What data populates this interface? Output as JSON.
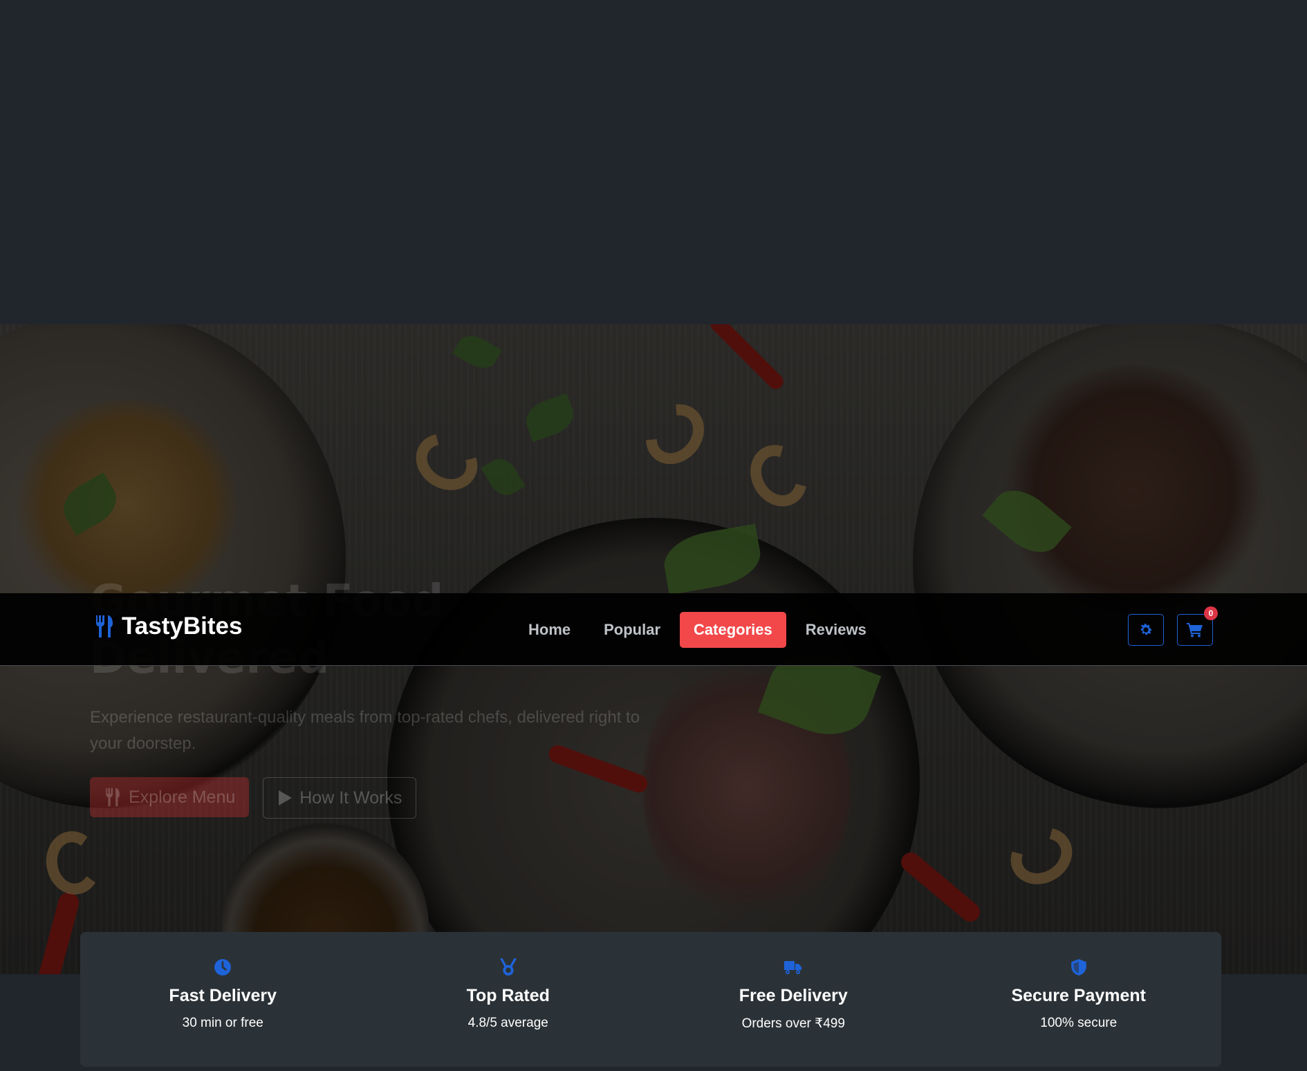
{
  "brand": {
    "name": "TastyBites",
    "logo_icon": "utensils-icon"
  },
  "nav": {
    "links": [
      {
        "label": "Home",
        "active": false
      },
      {
        "label": "Popular",
        "active": false
      },
      {
        "label": "Categories",
        "active": true
      },
      {
        "label": "Reviews",
        "active": false
      }
    ],
    "settings_icon": "gear-icon",
    "cart_icon": "cart-icon",
    "cart_count": "0"
  },
  "hero": {
    "title": "Gourmet Food Delivered",
    "subtitle": "Experience restaurant-quality meals from top-rated chefs, delivered right to your doorstep.",
    "explore_label": "Explore Menu",
    "how_label": "How It Works"
  },
  "features": [
    {
      "icon": "clock-icon",
      "title": "Fast Delivery",
      "desc": "30 min or free"
    },
    {
      "icon": "medal-icon",
      "title": "Top Rated",
      "desc": "4.8/5 average"
    },
    {
      "icon": "truck-icon",
      "title": "Free Delivery",
      "desc": "Orders over ₹499"
    },
    {
      "icon": "shield-icon",
      "title": "Secure Payment",
      "desc": "100% secure"
    }
  ],
  "colors": {
    "accent_red": "#f2484a",
    "accent_blue": "#1e63d8",
    "page_bg": "#21252c",
    "features_bg": "#2b3237"
  }
}
